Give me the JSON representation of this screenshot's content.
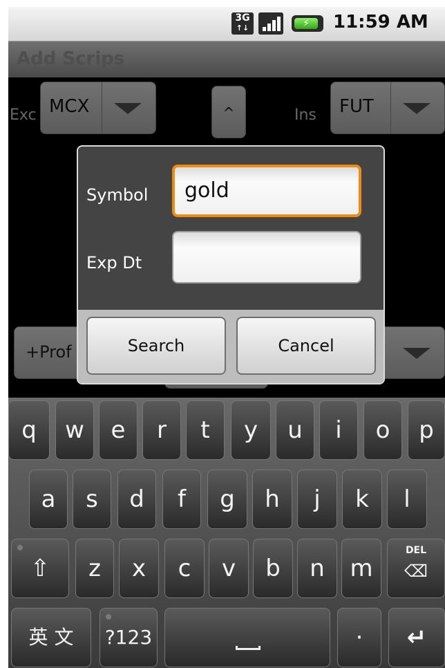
{
  "status_bar": {
    "network_type": "3G",
    "time": "11:59 AM",
    "icons": [
      "3g-data-icon",
      "signal-strength-icon",
      "battery-charging-icon"
    ]
  },
  "title_bar": {
    "title": "Add Scrips"
  },
  "background_form": {
    "exchange_label": "Exc",
    "exchange_value": "MCX",
    "collapse_button_label": "^",
    "instrument_label": "Ins",
    "instrument_value": "FUT",
    "profile_button_label": "+Prof"
  },
  "dialog": {
    "symbol_label": "Symbol",
    "symbol_value": "gold",
    "exp_dt_label": "Exp Dt",
    "exp_dt_value": "",
    "search_button": "Search",
    "cancel_button": "Cancel"
  },
  "keyboard": {
    "row1": [
      "q",
      "w",
      "e",
      "r",
      "t",
      "y",
      "u",
      "i",
      "o",
      "p"
    ],
    "row2": [
      "a",
      "s",
      "d",
      "f",
      "g",
      "h",
      "j",
      "k",
      "l"
    ],
    "row3": [
      "z",
      "x",
      "c",
      "v",
      "b",
      "n",
      "m"
    ],
    "shift_label": "⇧",
    "delete_label": "DEL",
    "language_label": "英 文",
    "symbols_label": "?123",
    "space_label": "␣",
    "period_label": "·",
    "enter_label": "↵"
  },
  "colors": {
    "focus_border": "#f08a14",
    "battery_green": "#36a41c"
  }
}
